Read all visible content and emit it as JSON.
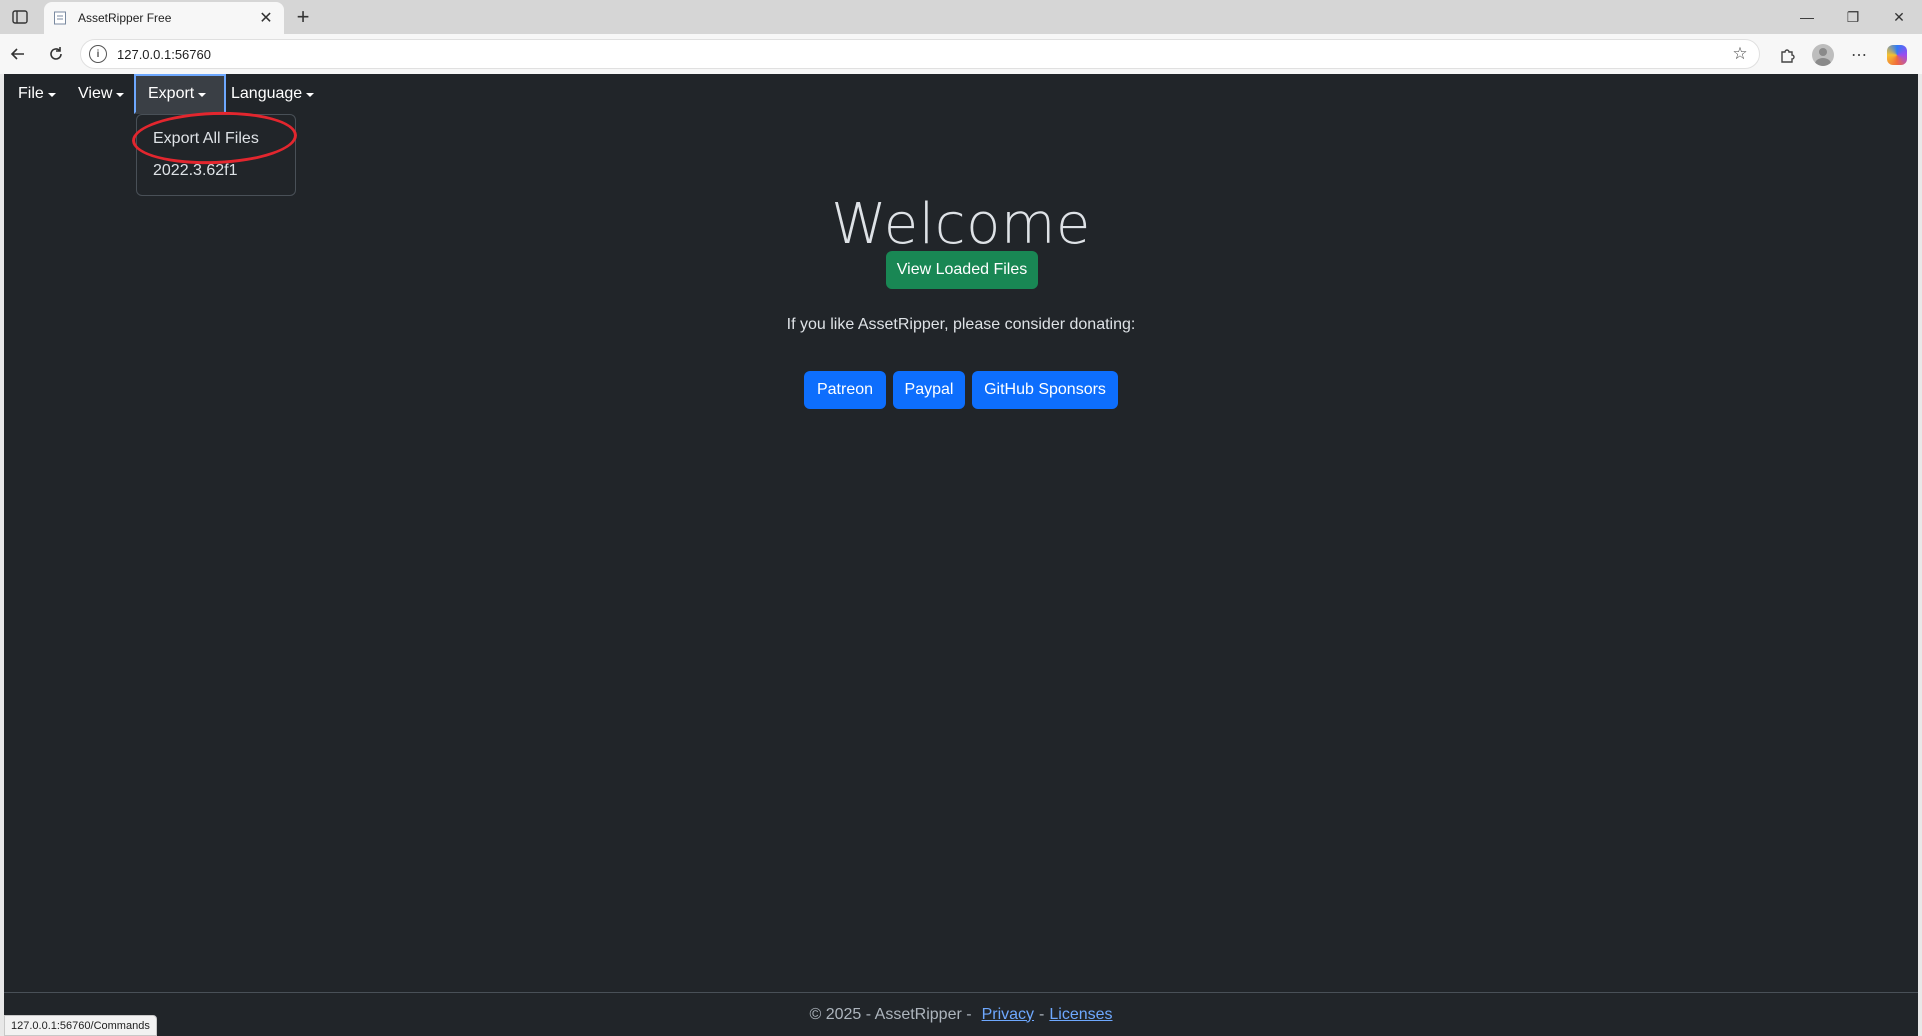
{
  "browser": {
    "tab_title": "AssetRipper Free",
    "new_tab_symbol": "+",
    "url": "127.0.0.1:56760",
    "status_url": "127.0.0.1:56760/Commands",
    "window_controls": {
      "minimize": "—",
      "restore": "❐",
      "close": "✕"
    }
  },
  "navbar": {
    "items": [
      {
        "label": "File"
      },
      {
        "label": "View"
      },
      {
        "label": "Export"
      },
      {
        "label": "Language"
      }
    ],
    "open_menu": "Export",
    "dropdown_items": [
      {
        "label": "Export All Files"
      },
      {
        "label": "2022.3.62f1"
      }
    ]
  },
  "main": {
    "heading": "Welcome",
    "view_loaded_button": "View Loaded Files",
    "donate_text": "If you like AssetRipper, please consider donating:",
    "donate_buttons": [
      {
        "label": "Patreon"
      },
      {
        "label": "Paypal"
      },
      {
        "label": "GitHub Sponsors"
      }
    ]
  },
  "footer": {
    "copyright": "© 2025 - AssetRipper -",
    "privacy": "Privacy",
    "separator": "-",
    "licenses": "Licenses"
  },
  "colors": {
    "app_bg": "#212529",
    "success": "#198754",
    "primary": "#0d6efd",
    "link": "#6ea8fe",
    "annotation_ring": "#e3262e"
  },
  "icons": {
    "tab_actions": "tab-actions-icon",
    "favicon": "page-favicon-icon",
    "back": "back-arrow-icon",
    "refresh": "refresh-icon",
    "site_info": "info-icon",
    "favorite": "star-icon",
    "extensions": "puzzle-icon",
    "profile": "profile-icon",
    "more": "more-dots-icon",
    "copilot": "copilot-icon"
  }
}
